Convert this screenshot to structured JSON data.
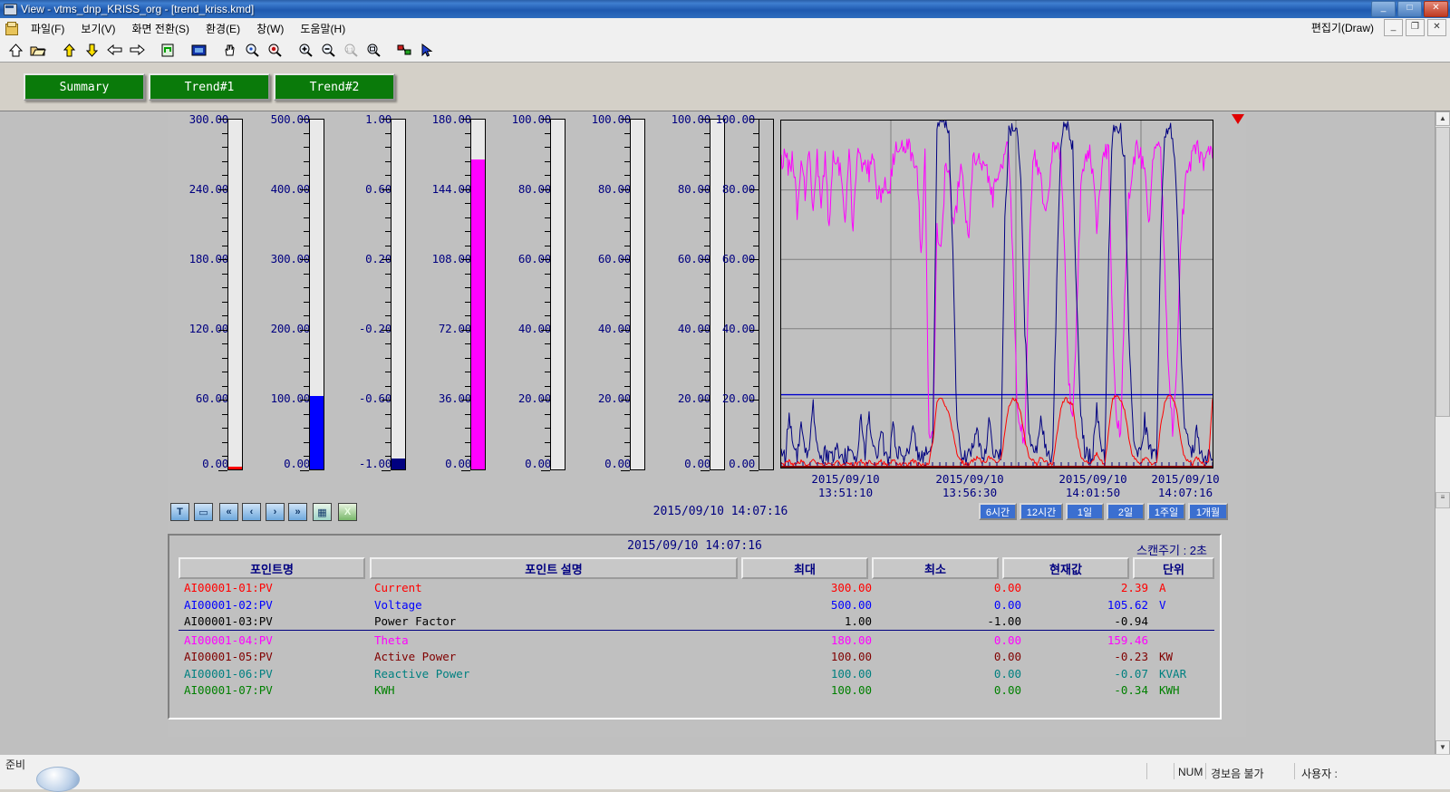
{
  "window": {
    "title": "View - vtms_dnp_KRISS_org - [trend_kriss.kmd]",
    "icon": "app-window-icon",
    "buttons": {
      "minimize": "_",
      "maximize": "□",
      "close": "✕"
    }
  },
  "menu": {
    "mdi_icon": "mdi-document-icon",
    "items": [
      {
        "label": "파일(F)"
      },
      {
        "label": "보기(V)"
      },
      {
        "label": "화면 전환(S)"
      },
      {
        "label": "환경(E)"
      },
      {
        "label": "창(W)"
      },
      {
        "label": "도움말(H)"
      }
    ],
    "right_label": "편집기(Draw)",
    "mdi_buttons": [
      {
        "name": "mdi-minimize-button",
        "glyph": "_"
      },
      {
        "name": "mdi-restore-button",
        "glyph": "❐"
      },
      {
        "name": "mdi-close-button",
        "glyph": "✕"
      }
    ]
  },
  "toolbar": {
    "buttons": [
      {
        "name": "home-icon",
        "title": "Home"
      },
      {
        "name": "open-folder-icon",
        "title": "Open"
      },
      {
        "name": "page-up-icon",
        "title": "Up"
      },
      {
        "name": "page-down-icon",
        "title": "Down"
      },
      {
        "name": "back-arrow-icon",
        "title": "Back"
      },
      {
        "name": "forward-arrow-icon",
        "title": "Forward"
      },
      {
        "name": "refresh-icon",
        "title": "Refresh"
      },
      {
        "name": "fullscreen-icon",
        "title": "Full screen"
      },
      {
        "name": "pan-hand-icon",
        "title": "Pan"
      },
      {
        "name": "zoom-area-icon",
        "title": "Zoom area"
      },
      {
        "name": "zoom-reset-icon",
        "title": "Zoom reset"
      },
      {
        "name": "zoom-in-icon",
        "title": "Zoom in"
      },
      {
        "name": "zoom-out-icon",
        "title": "Zoom out"
      },
      {
        "name": "zoom-100-icon",
        "title": "Zoom 100%"
      },
      {
        "name": "zoom-fit-icon",
        "title": "Zoom fit"
      },
      {
        "name": "tag-link-icon",
        "title": "Tag"
      },
      {
        "name": "pointer-icon",
        "title": "Select"
      }
    ]
  },
  "tabs": [
    {
      "label": "Summary",
      "name": "tab-summary"
    },
    {
      "label": "Trend#1",
      "name": "tab-trend1"
    },
    {
      "label": "Trend#2",
      "name": "tab-trend2"
    }
  ],
  "gauges": [
    {
      "name": "gauge-current",
      "ticks": [
        "300.00",
        "240.00",
        "180.00",
        "120.00",
        "60.00",
        "0.00"
      ],
      "fill_pct": 0.8,
      "color": "#ff0000",
      "min": 0,
      "max": 300
    },
    {
      "name": "gauge-voltage",
      "ticks": [
        "500.00",
        "400.00",
        "300.00",
        "200.00",
        "100.00",
        "0.00"
      ],
      "fill_pct": 21.1,
      "color": "#0000ff",
      "min": 0,
      "max": 500
    },
    {
      "name": "gauge-power-factor",
      "ticks": [
        "1.00",
        "0.60",
        "0.20",
        "-0.20",
        "-0.60",
        "-1.00"
      ],
      "fill_pct": 3.0,
      "color": "#000080",
      "min": -1,
      "max": 1
    },
    {
      "name": "gauge-theta",
      "ticks": [
        "180.00",
        "144.00",
        "108.00",
        "72.00",
        "36.00",
        "0.00"
      ],
      "fill_pct": 88.6,
      "color": "#ff00ff",
      "min": 0,
      "max": 180
    },
    {
      "name": "gauge-active-power",
      "ticks": [
        "100.00",
        "80.00",
        "60.00",
        "40.00",
        "20.00",
        "0.00"
      ],
      "fill_pct": 0,
      "color": "#800000",
      "min": 0,
      "max": 100
    },
    {
      "name": "gauge-reactive-power",
      "ticks": [
        "100.00",
        "80.00",
        "60.00",
        "40.00",
        "20.00",
        "0.00"
      ],
      "fill_pct": 0,
      "color": "#008080",
      "min": 0,
      "max": 100
    },
    {
      "name": "gauge-kwh",
      "ticks": [
        "100.00",
        "80.00",
        "60.00",
        "40.00",
        "20.00",
        "0.00"
      ],
      "fill_pct": 0,
      "color": "#008000",
      "min": 0,
      "max": 100
    }
  ],
  "chart_data": {
    "type": "line",
    "title": "",
    "xlabel": "",
    "ylabel": "",
    "ylim": [
      0,
      100
    ],
    "yticks": [
      "100.00",
      "80.00",
      "60.00",
      "40.00",
      "20.00",
      "0.00"
    ],
    "grid": true,
    "legend_position": "none",
    "x_tick_labels": [
      {
        "date": "2015/09/10",
        "time": "13:51:10"
      },
      {
        "date": "2015/09/10",
        "time": "13:56:30"
      },
      {
        "date": "2015/09/10",
        "time": "14:01:50"
      },
      {
        "date": "2015/09/10",
        "time": "14:07:16"
      }
    ],
    "series": [
      {
        "name": "Theta",
        "color": "#ff00ff",
        "values": [
          88,
          90,
          86,
          89,
          74,
          90,
          79,
          91,
          72,
          90,
          76,
          89,
          69,
          90,
          88,
          86,
          73,
          91,
          68,
          90,
          87,
          90,
          85,
          89,
          80,
          78,
          81,
          79,
          89,
          92,
          91,
          93,
          92,
          90,
          88,
          60,
          92,
          10,
          8,
          70,
          62,
          84,
          88,
          70,
          76,
          90,
          74,
          66,
          90,
          90,
          86,
          88,
          82,
          78,
          84,
          88,
          90,
          92,
          62,
          20,
          10,
          8,
          56,
          90,
          88,
          84,
          74,
          80,
          92,
          91,
          90,
          60,
          26,
          12,
          44,
          80,
          90,
          92,
          86,
          68,
          82,
          92,
          91,
          40,
          14,
          9,
          48,
          78,
          88,
          92,
          90,
          86,
          70,
          88,
          92,
          90,
          60,
          26,
          12,
          30,
          64,
          80,
          86,
          90,
          92,
          90,
          88,
          92,
          91
        ]
      },
      {
        "name": "Voltage",
        "color": "#000080",
        "values": [
          4,
          3,
          16,
          6,
          3,
          14,
          4,
          3,
          18,
          7,
          3,
          4,
          3,
          3,
          5,
          4,
          3,
          4,
          3,
          3,
          14,
          4,
          16,
          5,
          3,
          11,
          4,
          3,
          12,
          5,
          3,
          4,
          6,
          10,
          5,
          3,
          4,
          3,
          8,
          96,
          100,
          99,
          97,
          60,
          12,
          5,
          3,
          4,
          6,
          12,
          4,
          3,
          14,
          6,
          3,
          4,
          70,
          96,
          99,
          97,
          82,
          40,
          12,
          5,
          4,
          16,
          6,
          3,
          4,
          52,
          94,
          99,
          98,
          92,
          46,
          14,
          5,
          3,
          4,
          18,
          6,
          3,
          62,
          98,
          100,
          97,
          88,
          42,
          12,
          5,
          4,
          14,
          6,
          3,
          4,
          66,
          96,
          98,
          96,
          80,
          38,
          12,
          6,
          4,
          10,
          5,
          3,
          4,
          3
        ]
      },
      {
        "name": "Current",
        "color": "#ff0000",
        "values": [
          1,
          1,
          2,
          1,
          1,
          2,
          1,
          1,
          2,
          1,
          1,
          1,
          1,
          1,
          2,
          1,
          1,
          1,
          1,
          1,
          2,
          1,
          2,
          1,
          1,
          2,
          1,
          1,
          2,
          1,
          1,
          1,
          1,
          2,
          1,
          1,
          1,
          1,
          8,
          19,
          20,
          18,
          16,
          10,
          4,
          2,
          1,
          1,
          2,
          3,
          2,
          1,
          3,
          2,
          1,
          2,
          10,
          18,
          20,
          19,
          16,
          8,
          3,
          2,
          1,
          3,
          2,
          1,
          1,
          9,
          17,
          20,
          19,
          18,
          9,
          3,
          2,
          1,
          2,
          4,
          2,
          1,
          11,
          20,
          21,
          19,
          17,
          9,
          3,
          2,
          1,
          3,
          2,
          1,
          1,
          12,
          19,
          21,
          20,
          17,
          8,
          3,
          2,
          1,
          3,
          2,
          1,
          2,
          20
        ]
      },
      {
        "name": "Power Factor (scaled)",
        "color": "#0000cc",
        "constant": 21.0,
        "values": []
      }
    ]
  },
  "chart_controls": {
    "left_buttons": [
      {
        "name": "trend-cursor-button",
        "glyph": "T"
      },
      {
        "name": "trend-comment-button",
        "glyph": "▭"
      },
      {
        "name": "scroll-fast-back-button",
        "glyph": "«"
      },
      {
        "name": "scroll-back-button",
        "glyph": "‹"
      },
      {
        "name": "scroll-forward-button",
        "glyph": "›"
      },
      {
        "name": "scroll-fast-forward-button",
        "glyph": "»"
      },
      {
        "name": "calendar-button",
        "glyph": "▦"
      },
      {
        "name": "excel-export-button",
        "glyph": "X"
      }
    ],
    "timestamp": "2015/09/10 14:07:16",
    "range_buttons": [
      {
        "name": "range-6h-button",
        "label": "6시간"
      },
      {
        "name": "range-12h-button",
        "label": "12시간"
      },
      {
        "name": "range-1day-button",
        "label": "1일"
      },
      {
        "name": "range-2day-button",
        "label": "2일"
      },
      {
        "name": "range-1week-button",
        "label": "1주일"
      },
      {
        "name": "range-1month-button",
        "label": "1개월"
      }
    ]
  },
  "table": {
    "timestamp": "2015/09/10 14:07:16",
    "scan_label": "스캔주기  :  2초",
    "headers": [
      {
        "label": "포인트명",
        "name": "header-point-name"
      },
      {
        "label": "포인트 설명",
        "name": "header-point-description"
      },
      {
        "label": "최대",
        "name": "header-max"
      },
      {
        "label": "최소",
        "name": "header-min"
      },
      {
        "label": "현재값",
        "name": "header-current"
      },
      {
        "label": "단위",
        "name": "header-unit"
      }
    ],
    "rows": [
      {
        "point": "AI00001-01:PV",
        "desc": "Current",
        "max": "300.00",
        "min": "0.00",
        "cur": "2.39",
        "unit": "A",
        "color": "#ff0000"
      },
      {
        "point": "AI00001-02:PV",
        "desc": "Voltage",
        "max": "500.00",
        "min": "0.00",
        "cur": "105.62",
        "unit": "V",
        "color": "#0000ff"
      },
      {
        "point": "AI00001-03:PV",
        "desc": "Power Factor",
        "max": "1.00",
        "min": "-1.00",
        "cur": "-0.94",
        "unit": "",
        "color": "#000000"
      },
      {
        "point": "AI00001-04:PV",
        "desc": "Theta",
        "max": "180.00",
        "min": "0.00",
        "cur": "159.46",
        "unit": "",
        "color": "#ff00ff"
      },
      {
        "point": "AI00001-05:PV",
        "desc": "Active Power",
        "max": "100.00",
        "min": "0.00",
        "cur": "-0.23",
        "unit": "KW",
        "color": "#800000"
      },
      {
        "point": "AI00001-06:PV",
        "desc": "Reactive Power",
        "max": "100.00",
        "min": "0.00",
        "cur": "-0.07",
        "unit": "KVAR",
        "color": "#008080"
      },
      {
        "point": "AI00001-07:PV",
        "desc": "KWH",
        "max": "100.00",
        "min": "0.00",
        "cur": "-0.34",
        "unit": "KWH",
        "color": "#008000"
      }
    ]
  },
  "statusbar": {
    "ready": "준비",
    "num": "NUM",
    "alarm": "경보음 불가",
    "user": "사용자 :"
  }
}
